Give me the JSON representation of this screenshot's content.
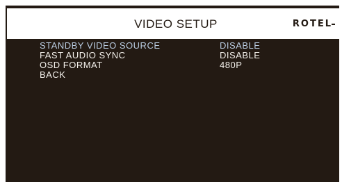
{
  "screen": {
    "title": "VIDEO SETUP",
    "brand_logo": "ROTEL"
  },
  "menu": {
    "items": [
      {
        "label": "STANDBY VIDEO SOURCE",
        "value": "DISABLE",
        "selected": true
      },
      {
        "label": "FAST AUDIO SYNC",
        "value": "DISABLE",
        "selected": false
      },
      {
        "label": "OSD FORMAT",
        "value": "480P",
        "selected": false
      },
      {
        "label": "BACK",
        "value": "",
        "selected": false
      }
    ]
  },
  "colors": {
    "background": "#231a13",
    "header_background": "#ffffff",
    "text": "#f2efea",
    "highlight_text": "#b9cbe0"
  }
}
